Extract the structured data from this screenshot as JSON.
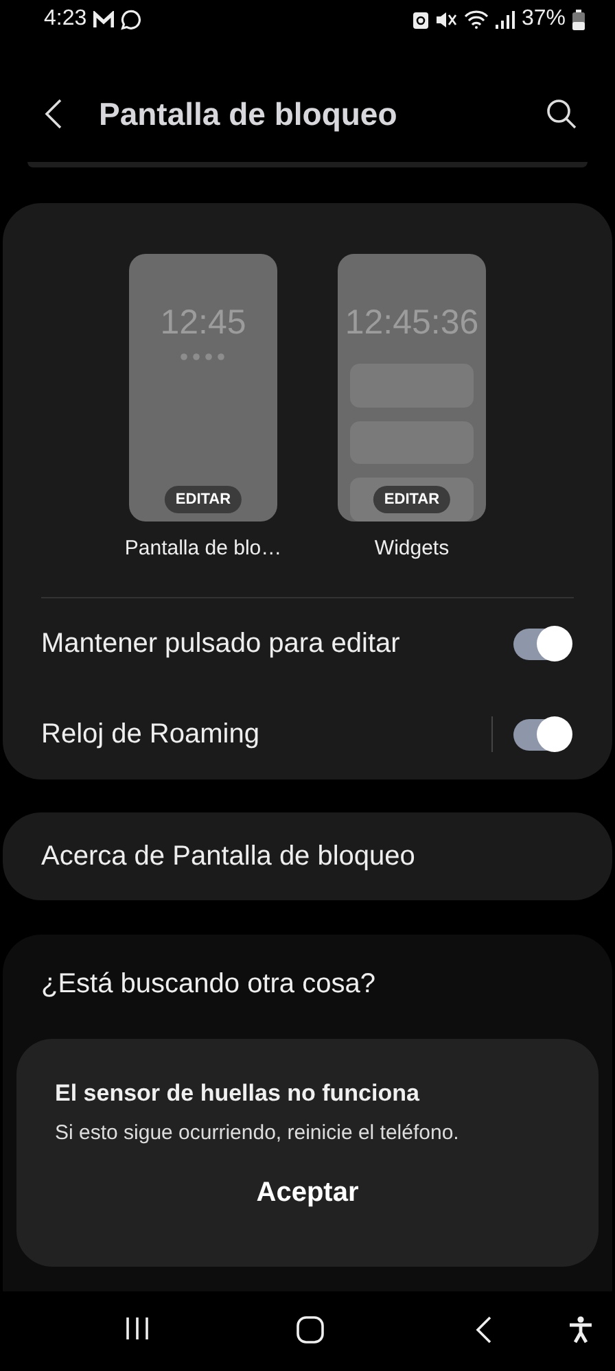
{
  "status_bar": {
    "time": "4:23",
    "battery": "37%"
  },
  "header": {
    "title": "Pantalla de bloqueo"
  },
  "previews": [
    {
      "kind": "lock",
      "clock": "12:45",
      "button": "EDITAR",
      "label": "Pantalla de blo…"
    },
    {
      "kind": "widgets",
      "clock": "12:45:36",
      "button": "EDITAR",
      "label": "Widgets"
    }
  ],
  "toggles": [
    {
      "label": "Mantener pulsado para editar",
      "on": true,
      "divider": false
    },
    {
      "label": "Reloj de Roaming",
      "on": true,
      "divider": true
    }
  ],
  "about": {
    "label": "Acerca de Pantalla de bloqueo"
  },
  "suggestions": {
    "title": "¿Está buscando otra cosa?"
  },
  "dialog": {
    "title": "El sensor de huellas no funciona",
    "message": "Si esto sigue ocurriendo, reinicie el teléfono.",
    "button": "Aceptar"
  }
}
